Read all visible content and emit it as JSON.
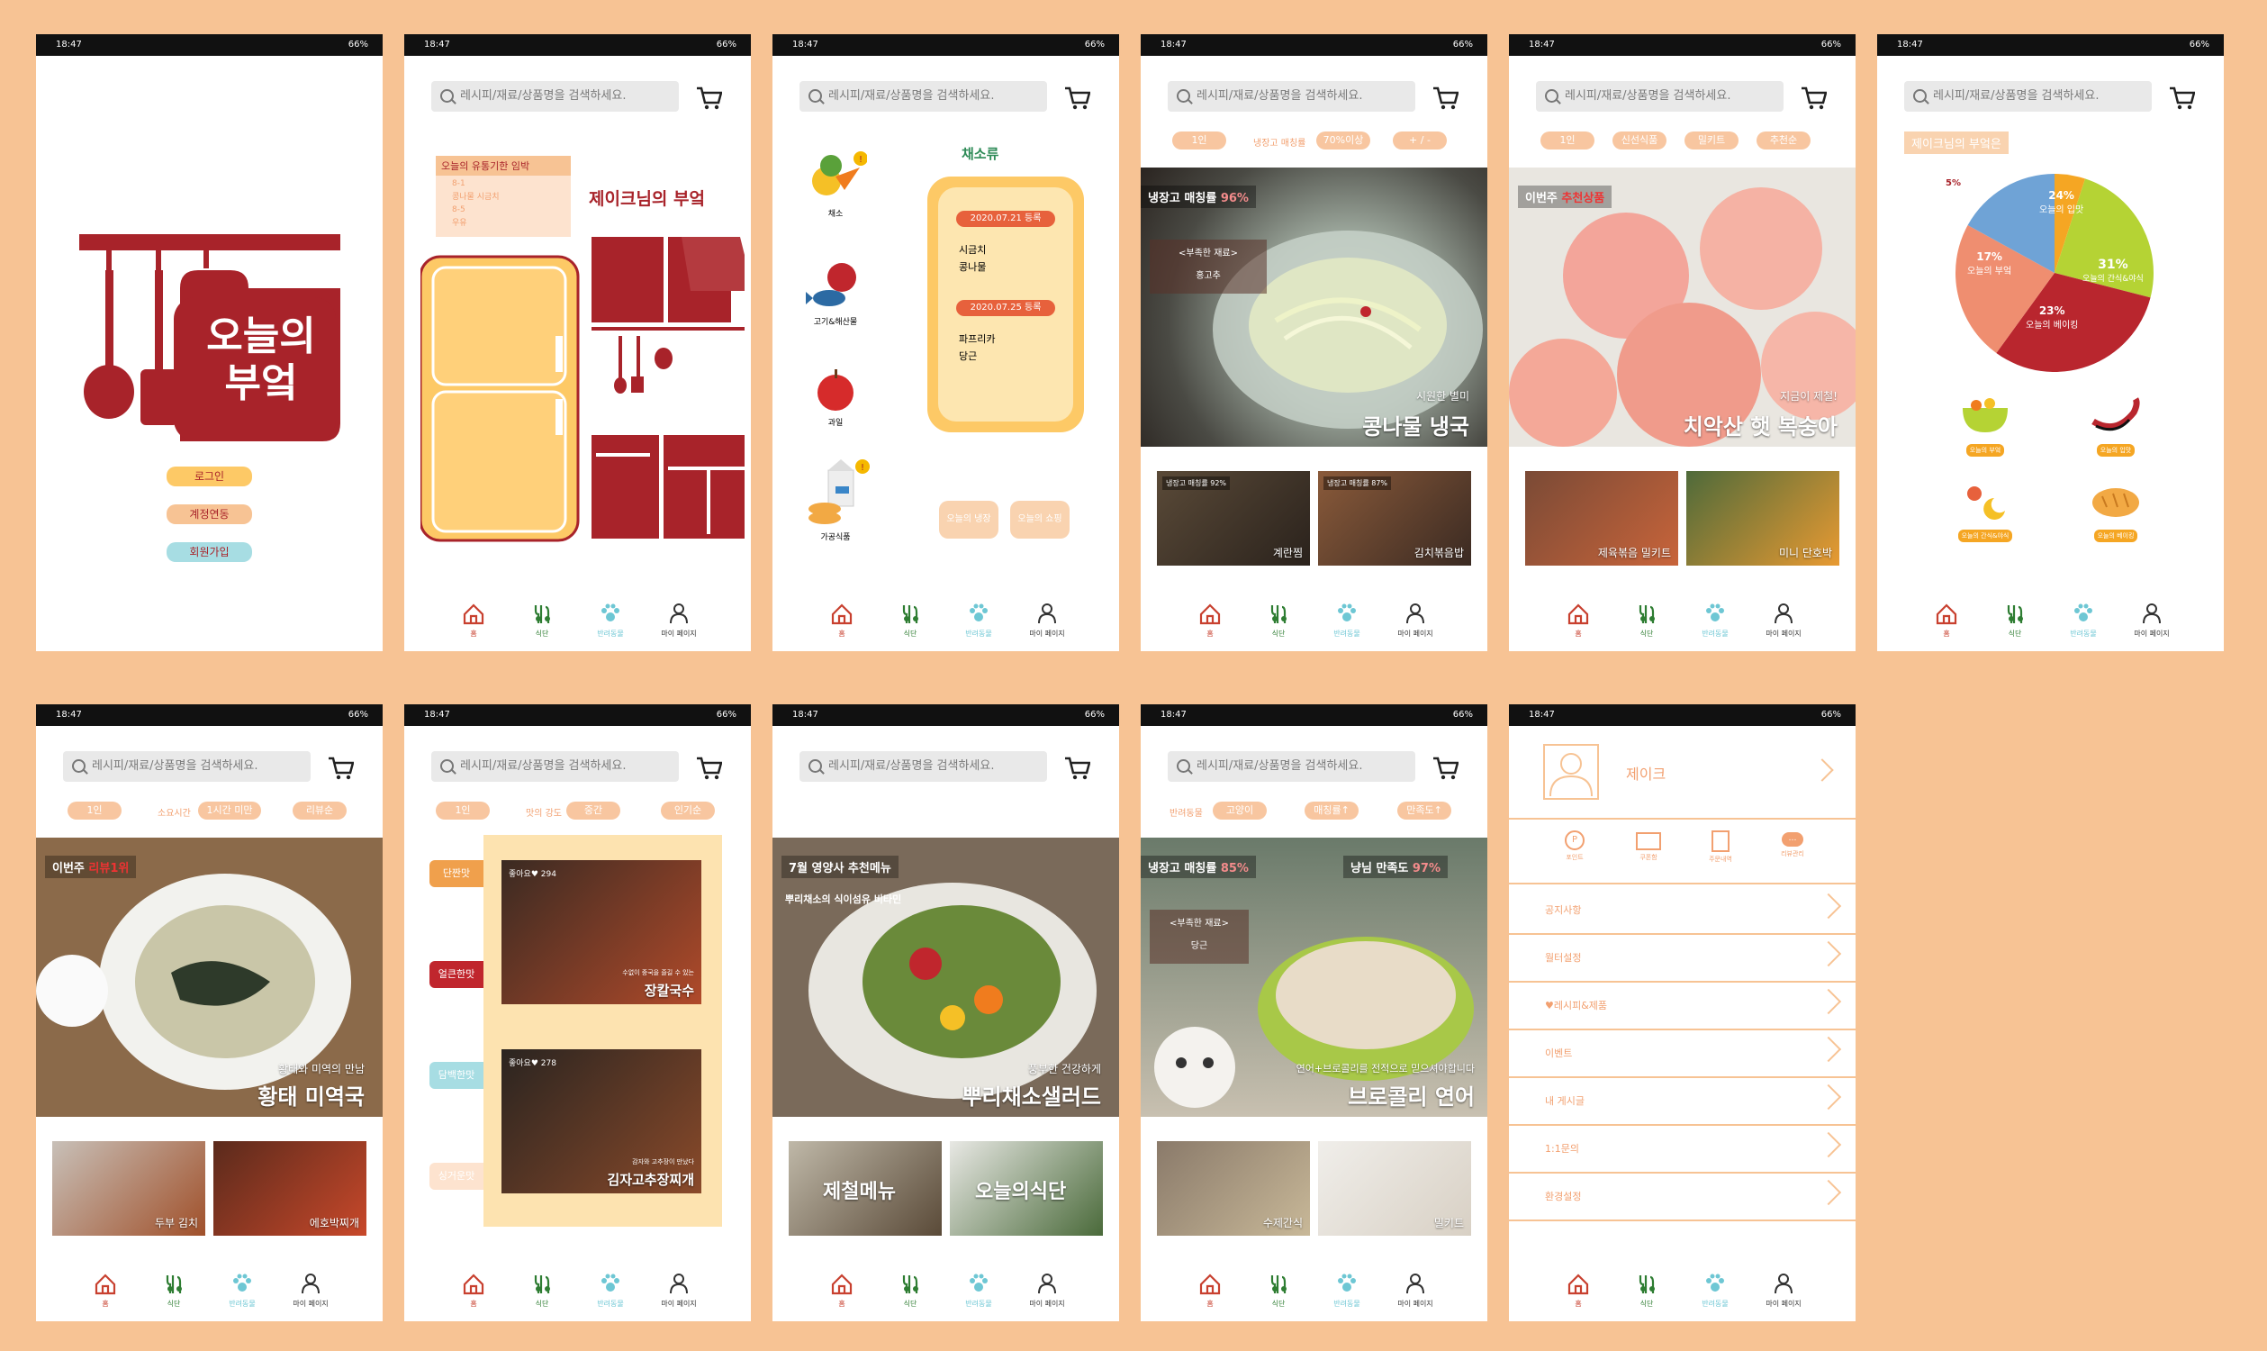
{
  "status": {
    "time": "18:47",
    "battery": "66%"
  },
  "search_placeholder": "레시피/재료/상품명을 검색하세요.",
  "nav": {
    "home": "홈",
    "diet": "식단",
    "pets": "반려동물",
    "mypage": "마이 페이지"
  },
  "colors": {
    "brand_red": "#a8232a",
    "orange": "#f7c394",
    "peach": "#f6a06c",
    "teal": "#6ec7d4",
    "yellow": "#fdc966"
  },
  "screen1": {
    "logo_line1": "오늘의",
    "logo_line2": "부엌",
    "login": "로그인",
    "link": "계정연동",
    "signup": "회원가입"
  },
  "screen2": {
    "expiry_title": "오늘의 유통기한 임박",
    "expiry_line1": "8-1",
    "expiry_line2": "콩나물 시금치",
    "expiry_line3": "8-5",
    "expiry_line4": "우유",
    "kitchen_title": "제이크님의 부엌"
  },
  "screen3": {
    "cat_veg": "채소",
    "cat_meat": "고기&해산물",
    "cat_fruit": "과일",
    "cat_processed": "가공식품",
    "list_title": "채소류",
    "date1": "2020.07.21 등록",
    "item1a": "시금치",
    "item1b": "콩나물",
    "date2": "2020.07.25 등록",
    "item2a": "파프리카",
    "item2b": "당근",
    "btn_fridge": "오늘의 냉장",
    "btn_shop": "오늘의 쇼핑"
  },
  "screen4": {
    "chip1": "1인",
    "chip_label": "냉장고 매칭률",
    "chip2": "70%이상",
    "chip3": "+ / -",
    "match": "냉장고 매칭률",
    "match_pct": "96%",
    "lack": "<부족한 재료>",
    "lack_item": "홍고추",
    "sub": "시원한 별미",
    "title": "콩나물 냉국",
    "thumb1_tag": "냉장고 매칭률 92%",
    "thumb1": "계란찜",
    "thumb2_tag": "냉장고 매칭률 87%",
    "thumb2": "김치볶음밥"
  },
  "screen5": {
    "chip1": "1인",
    "chip2": "신선식품",
    "chip3": "밀키트",
    "chip4": "추천순",
    "badge": "이번주",
    "badge2": "추천상품",
    "sub": "지금이 제철!",
    "title": "치악산 햇 복숭아",
    "thumb1": "제육볶음 밀키트",
    "thumb2": "미니 단호박"
  },
  "screen6": {
    "title": "제이크님의 부엌은",
    "pie": [
      {
        "label": "오늘의 입맛",
        "pct": 24,
        "color": "#b5d334"
      },
      {
        "label": "오늘의 간식&야식",
        "pct": 31,
        "color": "#b9262e"
      },
      {
        "label": "오늘의 베이킹",
        "pct": 23,
        "color": "#ef8e70"
      },
      {
        "label": "오늘의 부엌",
        "pct": 17,
        "color": "#6fa3d6"
      },
      {
        "label": "오늘의 기타",
        "pct": 5,
        "color": "#f5a623"
      }
    ],
    "pct24": "24%",
    "lbl24": "오늘의 입맛",
    "pct31": "31%",
    "lbl31": "오늘의 간식&야식",
    "pct23": "23%",
    "lbl23": "오늘의 베이킹",
    "pct17": "17%",
    "lbl17": "오늘의 부엌",
    "pct5": "5%",
    "icon1": "오늘의 부엌",
    "icon2": "오늘의 입맛",
    "icon3": "오늘의 간식&야식",
    "icon4": "오늘의 베이킹"
  },
  "screen7": {
    "chip1": "1인",
    "chip_label": "소요시간",
    "chip2": "1시간 미만",
    "chip3": "리뷰순",
    "badge": "이번주",
    "badge2": "리뷰1위",
    "sub": "황태와 미역의 만남",
    "title": "황태 미역국",
    "thumb1": "두부 김치",
    "thumb2": "에호박찌개"
  },
  "screen8": {
    "chip1": "1인",
    "chip_label": "맛의 강도",
    "chip2": "중간",
    "chip3": "인기순",
    "side1": "단짠맛",
    "side2": "얼큰한맛",
    "side3": "담백한맛",
    "side4": "싱거운맛",
    "card1_like": "좋아요♥ 294",
    "card1_sub": "수없이 중국을 즐길 수 있는",
    "card1": "장칼국수",
    "card2_like": "좋아요♥ 278",
    "card2_sub": "감자와 고추장이 만났다",
    "card2": "김자고추장찌개"
  },
  "screen9": {
    "badge": "7월 영양사 추천메뉴",
    "desc": "뿌리채소의 식이섬유 비타민",
    "sub": "풍부한 건강하게",
    "title": "뿌리채소샐러드",
    "thumb1": "제철메뉴",
    "thumb2": "오늘의식단"
  },
  "screen10": {
    "chip_label": "반려동물",
    "chip1": "고양이",
    "chip2": "매칭률↑",
    "chip3": "만족도↑",
    "match": "냉장고 매칭률",
    "match_pct": "85%",
    "sat": "냥님 만족도",
    "sat_pct": "97%",
    "lack": "<부족한 재료>",
    "lack_item": "당근",
    "sub": "연어+브로콜리를 전적으로 믿으셔야합니다",
    "title": "브로콜리 연어",
    "thumb1": "수제간식",
    "thumb2": "밀키트"
  },
  "screen11": {
    "name": "제이크",
    "icon1": "포인트",
    "icon2": "쿠폰함",
    "icon3": "주문내역",
    "icon4": "리뷰관리",
    "menu": [
      "공지사항",
      "월터설정",
      "♥레시피&제품",
      "이벤트",
      "내 게시글",
      "1:1문의",
      "환경설정"
    ]
  }
}
